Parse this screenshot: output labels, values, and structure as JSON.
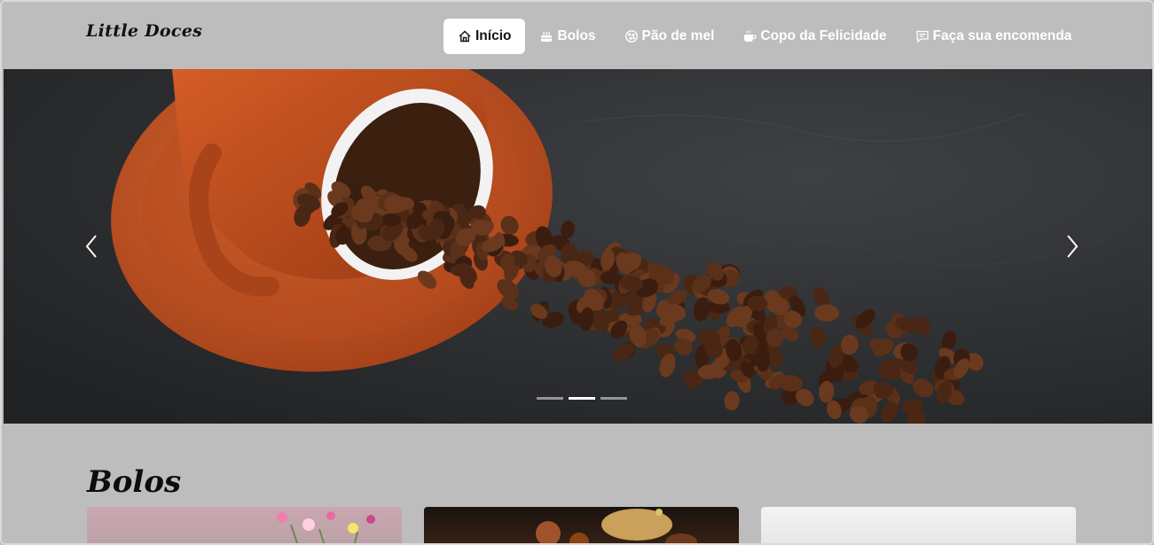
{
  "brand": {
    "name": "Little Doces"
  },
  "nav": {
    "items": [
      {
        "label": "Início",
        "icon": "home-icon",
        "active": true
      },
      {
        "label": "Bolos",
        "icon": "cake-icon",
        "active": false
      },
      {
        "label": "Pão de mel",
        "icon": "cookie-icon",
        "active": false
      },
      {
        "label": "Copo da Felicidade",
        "icon": "cup-icon",
        "active": false
      },
      {
        "label": "Faça sua encomenda",
        "icon": "chat-icon",
        "active": false
      }
    ]
  },
  "carousel": {
    "slide_count": 3,
    "active_index": 1,
    "prev_icon": "chevron-left-icon",
    "next_icon": "chevron-right-icon"
  },
  "section": {
    "title": "Bolos"
  },
  "colors": {
    "navbar_bg": "#bdbdbd",
    "accent_active": "#ffffff",
    "cup": "#c6501f",
    "beans": "#4a2714",
    "slate": "#2a2c2f"
  }
}
